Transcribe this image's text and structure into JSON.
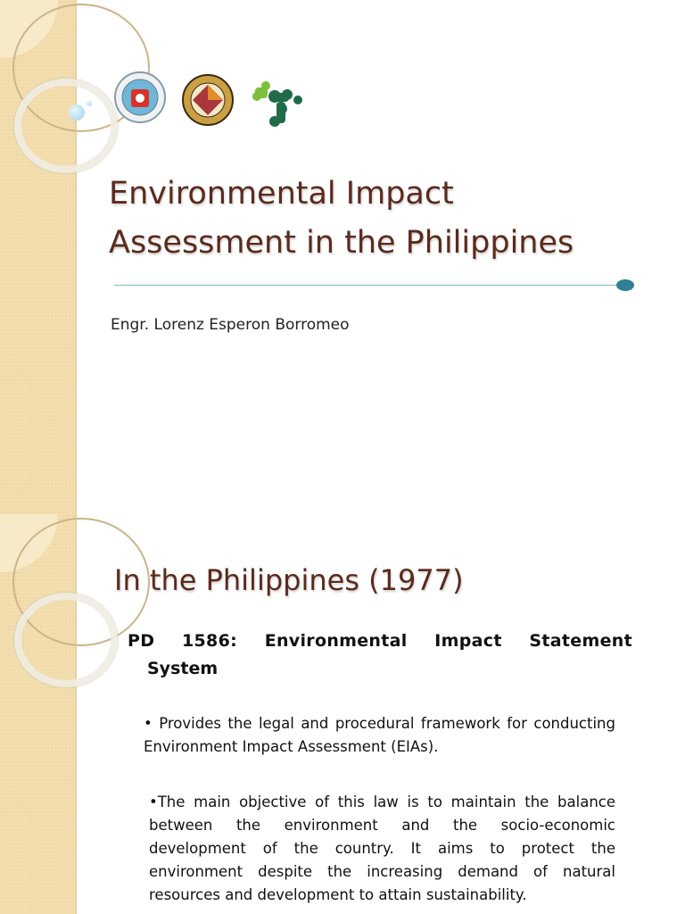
{
  "slide1": {
    "logos": [
      "bicol-university-seal",
      "college-of-engineering-seal",
      "green-molecule-logo"
    ],
    "title_line1": "Environmental Impact",
    "title_line2": "Assessment in the Philippines",
    "author": "Engr. Lorenz Esperon Borromeo"
  },
  "slide2": {
    "title": "In the Philippines (1977)",
    "subtitle_line1": "PD 1586: Environmental Impact Statement",
    "subtitle_line2": "System",
    "bullet1": "• Provides the legal and procedural framework for conducting Environment Impact Assessment (EIAs).",
    "bullet2": "•The main objective of this law is to maintain the balance between the environment and the socio-economic development of the country.  It aims to protect the environment despite the increasing demand of natural resources and development to attain sustainability."
  },
  "colors": {
    "title": "#5b2a1c",
    "accent": "#2f7f95",
    "sidebar": "#f3deb0"
  }
}
